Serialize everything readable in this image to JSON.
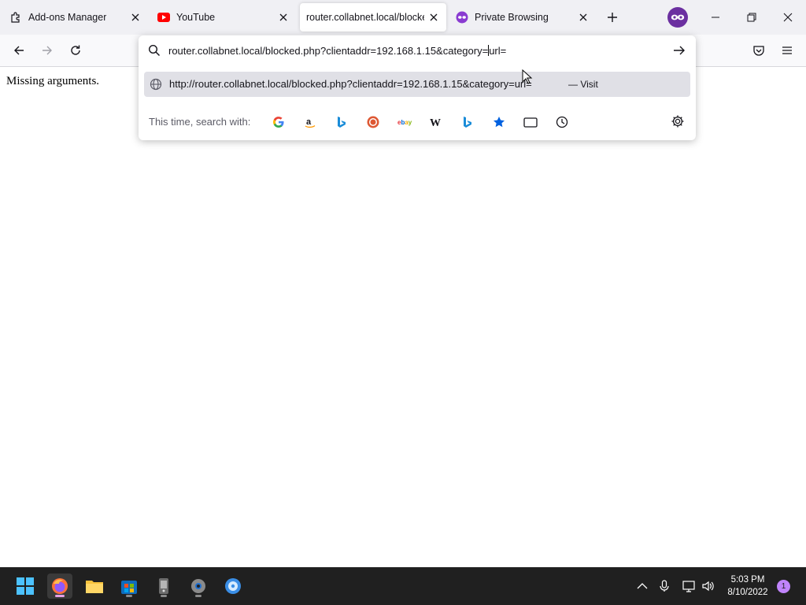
{
  "tabs": [
    {
      "label": "Add-ons Manager",
      "icon": "puzzle-icon"
    },
    {
      "label": "YouTube",
      "icon": "youtube-icon"
    },
    {
      "label": "router.collabnet.local/blocked.php",
      "icon": "none"
    },
    {
      "label": "Private Browsing",
      "icon": "private-browsing-icon"
    }
  ],
  "url_bar": {
    "typed_before_caret": "router.collabnet.local/blocked.php?clientaddr=192.168.1.15&category=",
    "typed_after_caret": "url="
  },
  "suggestion": {
    "url": "http://router.collabnet.local/blocked.php?clientaddr=192.168.1.15&category=url=",
    "action": "— Visit"
  },
  "search_with_label": "This time, search with:",
  "search_engines": [
    "google-icon",
    "amazon-icon",
    "bing-icon",
    "duckduckgo-icon",
    "ebay-icon",
    "wikipedia-icon",
    "bing-icon",
    "bookmarks-icon",
    "tabs-icon",
    "history-icon"
  ],
  "page": {
    "message": "Missing arguments."
  },
  "taskbar": {
    "time": "5:03 PM",
    "date": "8/10/2022",
    "notification_count": "1"
  },
  "colors": {
    "accent_private": "#6b2fa0",
    "taskbar_bg": "#202020",
    "tabstrip_bg": "#f0f0f4"
  }
}
